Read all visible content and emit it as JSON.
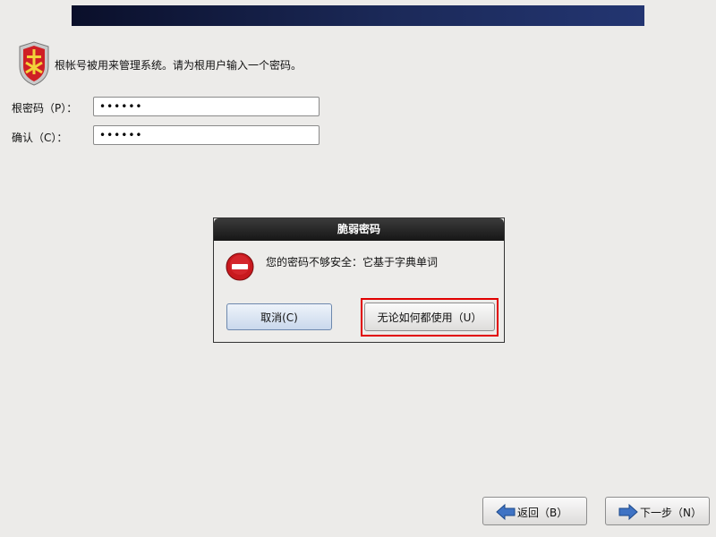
{
  "intro": {
    "text": "根帐号被用来管理系统。请为根用户输入一个密码。"
  },
  "fields": {
    "root_password": {
      "label": "根密码（P）：",
      "value": "••••••"
    },
    "confirm": {
      "label": "确认（C）：",
      "value": "••••••"
    }
  },
  "dialog": {
    "title": "脆弱密码",
    "message": "您的密码不够安全：它基于字典单词",
    "cancel_label": "取消(C)",
    "use_anyway_label": "无论如何都使用（U）"
  },
  "nav": {
    "back_label": "返回（B）",
    "next_label": "下一步（N）"
  },
  "colors": {
    "highlight": "#e10000",
    "banner": "#1b2958",
    "error": "#c8191e"
  }
}
